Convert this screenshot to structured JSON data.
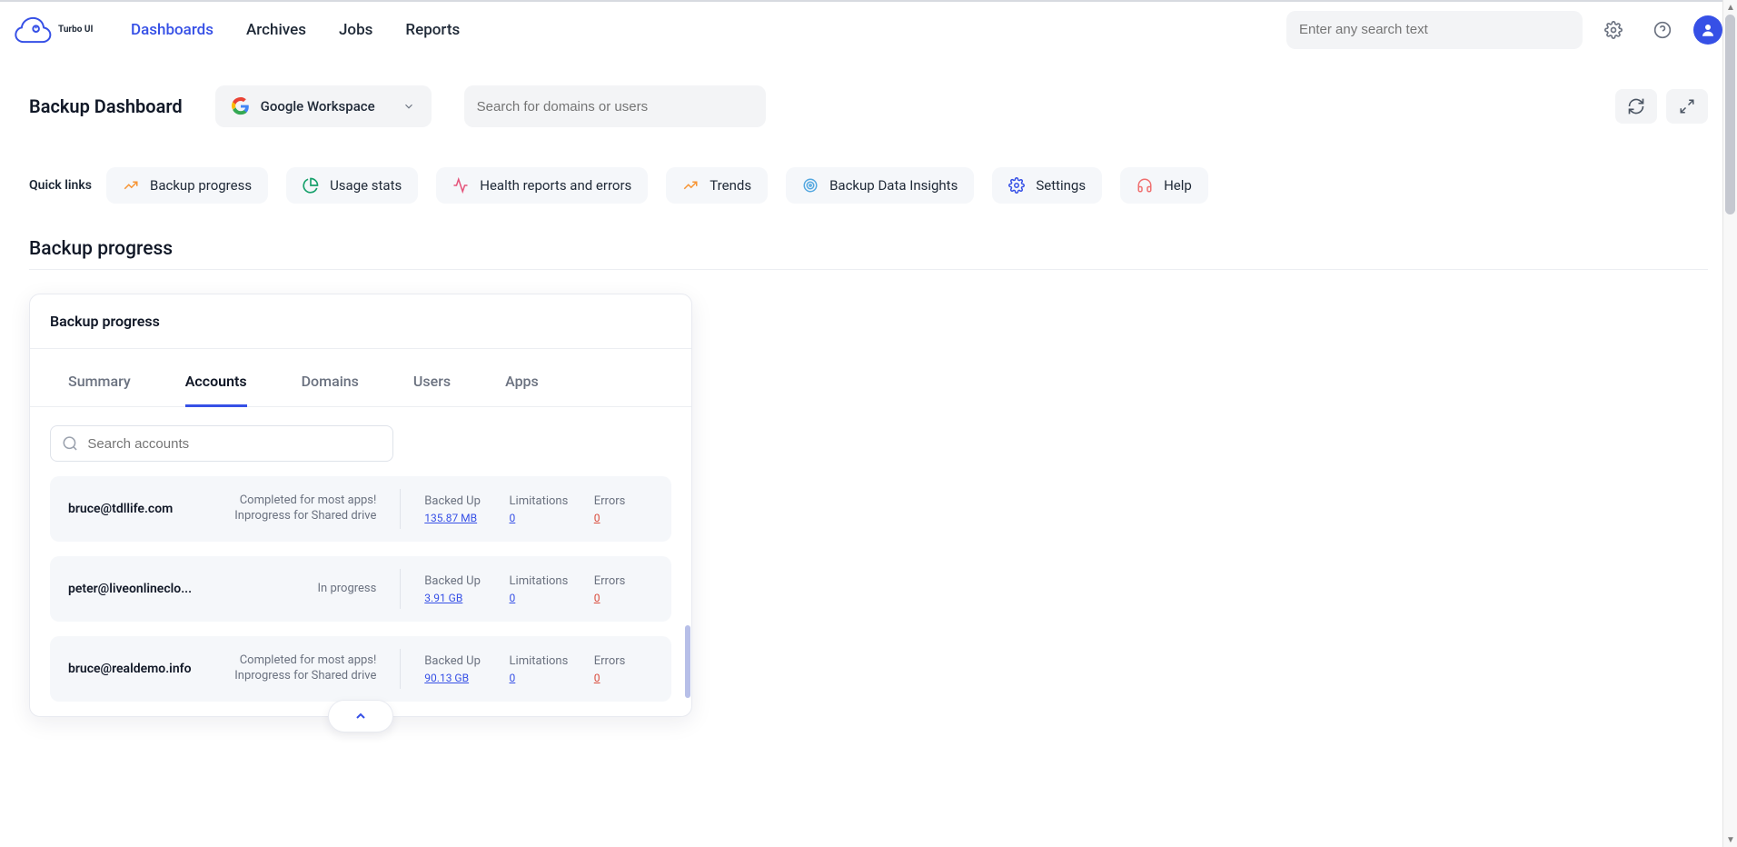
{
  "brand_name": "Turbo UI",
  "nav": {
    "dashboards": "Dashboards",
    "archives": "Archives",
    "jobs": "Jobs",
    "reports": "Reports"
  },
  "top_search_placeholder": "Enter any search text",
  "page_title": "Backup Dashboard",
  "workspace_selector": "Google Workspace",
  "domain_search_placeholder": "Search for domains or users",
  "quick_links_label": "Quick links",
  "quick_links": {
    "progress": "Backup progress",
    "usage": "Usage stats",
    "health": "Health reports and errors",
    "trends": "Trends",
    "insights": "Backup Data Insights",
    "settings": "Settings",
    "help": "Help"
  },
  "section_title": "Backup progress",
  "card": {
    "title": "Backup progress",
    "tabs": {
      "summary": "Summary",
      "accounts": "Accounts",
      "domains": "Domains",
      "users": "Users",
      "apps": "Apps"
    },
    "search_placeholder": "Search accounts",
    "col": {
      "backed_up": "Backed Up",
      "limitations": "Limitations",
      "errors": "Errors"
    },
    "rows": [
      {
        "email": "bruce@tdllife.com",
        "status_l1": "Completed for most apps!",
        "status_l2": "Inprogress for Shared drive",
        "backed_up": "135.87 MB",
        "limitations": "0",
        "errors": "0"
      },
      {
        "email": "peter@liveonlineclo...",
        "status_l1": "In progress",
        "status_l2": "",
        "backed_up": "3.91 GB",
        "limitations": "0",
        "errors": "0"
      },
      {
        "email": "bruce@realdemo.info",
        "status_l1": "Completed for most apps!",
        "status_l2": "Inprogress for Shared drive",
        "backed_up": "90.13 GB",
        "limitations": "0",
        "errors": "0"
      }
    ]
  }
}
